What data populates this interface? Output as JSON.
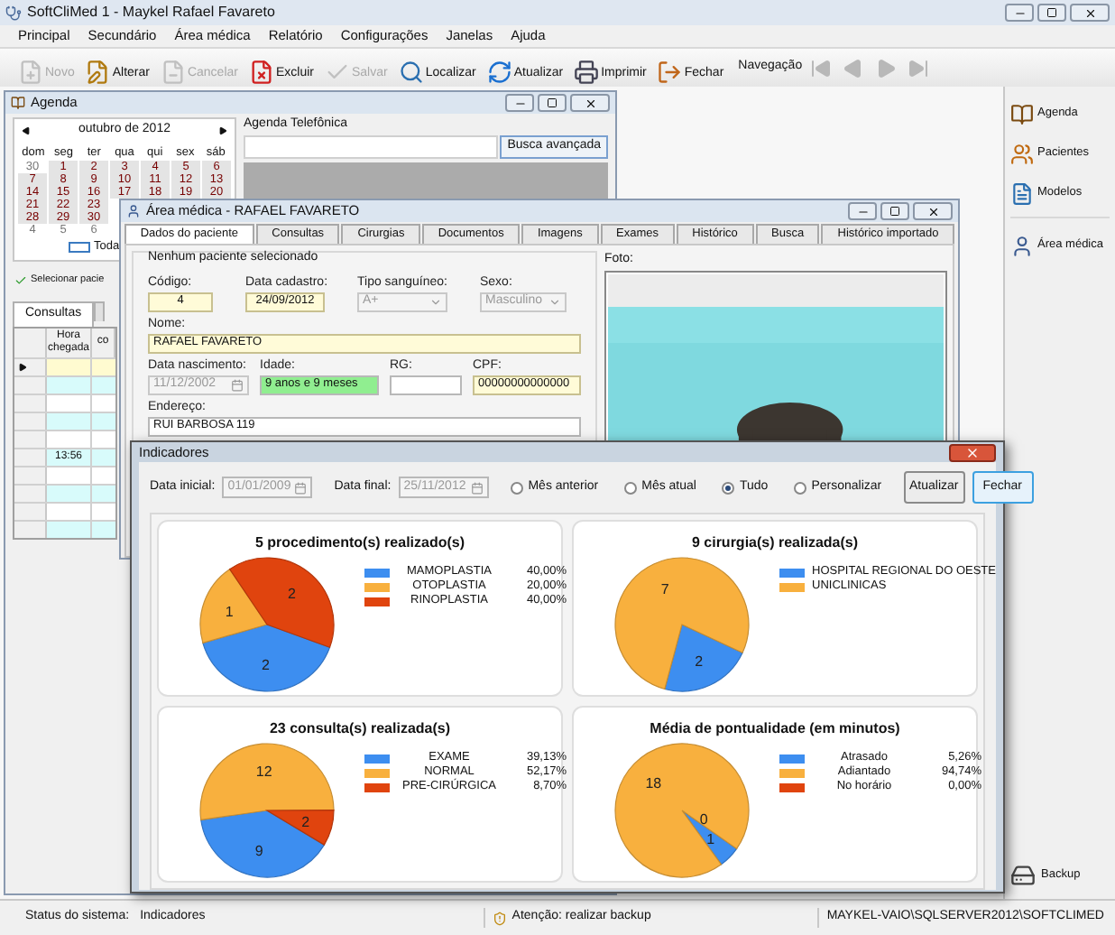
{
  "window": {
    "title": "SoftCliMed 1 - Maykel Rafael Favareto"
  },
  "menu": [
    "Principal",
    "Secundário",
    "Área médica",
    "Relatório",
    "Configurações",
    "Janelas",
    "Ajuda"
  ],
  "toolbar": [
    {
      "kind": "new",
      "label": "Novo",
      "disabled": true
    },
    {
      "kind": "edit",
      "label": "Alterar",
      "disabled": false
    },
    {
      "kind": "cancel",
      "label": "Cancelar",
      "disabled": true
    },
    {
      "kind": "delete",
      "label": "Excluir",
      "disabled": false
    },
    {
      "kind": "save",
      "label": "Salvar",
      "disabled": true
    },
    {
      "kind": "find",
      "label": "Localizar",
      "disabled": false
    },
    {
      "kind": "refresh",
      "label": "Atualizar",
      "disabled": false
    },
    {
      "kind": "print",
      "label": "Imprimir",
      "disabled": false
    },
    {
      "kind": "close",
      "label": "Fechar",
      "disabled": false
    }
  ],
  "navigation": {
    "label": "Navegação",
    "buttons": [
      {
        "kind": "first",
        "disabled": true
      },
      {
        "kind": "previous",
        "disabled": true
      },
      {
        "kind": "next",
        "disabled": true
      },
      {
        "kind": "last",
        "disabled": true
      }
    ]
  },
  "agenda_window": {
    "title": "Agenda",
    "calendar": {
      "month": "outubro de 2012",
      "weekdays": [
        "dom",
        "seg",
        "ter",
        "qua",
        "qui",
        "sex",
        "sáb"
      ],
      "weeks": [
        [
          {
            "day": "30",
            "other_month": true
          },
          {
            "day": "1",
            "other_month": false
          },
          {
            "day": "2",
            "other_month": false
          },
          {
            "day": "3",
            "other_month": false
          },
          {
            "day": "4",
            "other_month": false
          },
          {
            "day": "5",
            "other_month": false
          },
          {
            "day": "6",
            "other_month": false
          }
        ],
        [
          {
            "day": "7",
            "other_month": false
          },
          {
            "day": "8",
            "other_month": false
          },
          {
            "day": "9",
            "other_month": false
          },
          {
            "day": "10",
            "other_month": false
          },
          {
            "day": "11",
            "other_month": false
          },
          {
            "day": "12",
            "other_month": false
          },
          {
            "day": "13",
            "other_month": false
          }
        ],
        [
          {
            "day": "14",
            "other_month": false
          },
          {
            "day": "15",
            "other_month": false
          },
          {
            "day": "16",
            "other_month": false
          },
          {
            "day": "17",
            "other_month": false
          },
          {
            "day": "18",
            "other_month": false
          },
          {
            "day": "19",
            "other_month": false
          },
          {
            "day": "20",
            "other_month": false
          }
        ],
        [
          {
            "day": "21",
            "other_month": false
          },
          {
            "day": "22",
            "other_month": false
          },
          {
            "day": "23",
            "other_month": false
          }
        ],
        [
          {
            "day": "28",
            "other_month": false
          },
          {
            "day": "29",
            "other_month": false
          },
          {
            "day": "30",
            "other_month": false
          }
        ],
        [
          {
            "day": "4",
            "other_month": true
          },
          {
            "day": "5",
            "other_month": true
          },
          {
            "day": "6",
            "other_month": true
          }
        ]
      ],
      "today_label": "Toda"
    },
    "phone_book": {
      "title": "Agenda Telefônica",
      "button": "Busca avançada"
    },
    "select_patient": "Selecionar pacie",
    "tabs": [
      {
        "label": "Consultas",
        "selected": true
      }
    ],
    "grid": {
      "columns": [
        "Hora chegada",
        "co"
      ],
      "rows": [
        {
          "selected": true
        },
        {
          "selected": false
        },
        {
          "selected": false
        },
        {
          "selected": false
        },
        {
          "selected": false
        },
        {
          "selected": false,
          "arrival": "13:56"
        },
        {
          "selected": false
        },
        {
          "selected": false
        },
        {
          "selected": false
        },
        {
          "selected": false
        }
      ]
    }
  },
  "medical_window": {
    "title": "Área médica - RAFAEL FAVARETO",
    "tabs": [
      {
        "label": "Dados do paciente",
        "selected": true
      },
      {
        "label": "Consultas",
        "selected": false
      },
      {
        "label": "Cirurgias",
        "selected": false
      },
      {
        "label": "Documentos",
        "selected": false
      },
      {
        "label": "Imagens",
        "selected": false
      },
      {
        "label": "Exames",
        "selected": false
      },
      {
        "label": "Histórico",
        "selected": false
      },
      {
        "label": "Busca",
        "selected": false
      },
      {
        "label": "Histórico importado",
        "selected": false
      }
    ],
    "group_title": "Nenhum paciente selecionado",
    "field_rows": [
      [
        {
          "label": "Código:",
          "value": "4",
          "kind": "text",
          "required": true,
          "computed": false
        },
        {
          "label": "Data cadastro:",
          "value": "24/09/2012",
          "kind": "text",
          "required": true,
          "computed": false
        },
        {
          "label": "Tipo sanguíneo:",
          "value": "A+",
          "kind": "combo",
          "disabled": true
        },
        {
          "label": "Sexo:",
          "value": "Masculino",
          "kind": "combo",
          "disabled": true
        }
      ],
      [
        {
          "label": "Nome:",
          "value": "RAFAEL FAVARETO",
          "kind": "text",
          "required": true,
          "computed": false
        }
      ],
      [
        {
          "label": "Data nascimento:",
          "value": "11/12/2002",
          "kind": "date",
          "disabled": true
        },
        {
          "label": "Idade:",
          "value": "9 anos e 9 meses",
          "kind": "text",
          "required": false,
          "computed": true
        },
        {
          "label": "RG:",
          "kind": "text",
          "required": false,
          "computed": false
        },
        {
          "label": "CPF:",
          "value": "00000000000000",
          "kind": "text",
          "required": true,
          "computed": false
        }
      ],
      [
        {
          "label": "Endereço:",
          "value": "RUI BARBOSA 119",
          "kind": "text",
          "required": false,
          "computed": false
        }
      ]
    ],
    "photo_label": "Foto:"
  },
  "indicators": {
    "title": "Indicadores",
    "date_start": {
      "label": "Data inicial:",
      "value": "01/01/2009",
      "disabled": true
    },
    "date_end": {
      "label": "Data final:",
      "value": "25/11/2012",
      "disabled": true
    },
    "periods": [
      {
        "label": "Mês anterior",
        "selected": false
      },
      {
        "label": "Mês atual",
        "selected": false
      },
      {
        "label": "Tudo",
        "selected": true
      },
      {
        "label": "Personalizar",
        "selected": false
      }
    ],
    "buttons": [
      {
        "label": "Atualizar",
        "focused": false
      },
      {
        "label": "Fechar",
        "focused": true
      }
    ],
    "panels": [
      {
        "chart_data": {
          "type": "pie",
          "title": "5 procedimento(s) realizado(s)",
          "categories": [
            "MAMOPLASTIA",
            "OTOPLASTIA",
            "RINOPLASTIA"
          ],
          "values": [
            2,
            1,
            2
          ],
          "value_labels": [
            "2",
            "1",
            "2"
          ]
        },
        "legend": [
          {
            "color": "#3d8ef0",
            "percent": "40,00%"
          },
          {
            "color": "#f8b03e",
            "percent": "20,00%"
          },
          {
            "color": "#e0440e",
            "percent": "40,00%"
          }
        ]
      },
      {
        "chart_data": {
          "type": "pie",
          "title": "9 cirurgia(s) realizada(s)",
          "categories": [
            "HOSPITAL REGIONAL DO OESTE",
            "UNICLINICAS"
          ],
          "values": [
            2,
            7
          ],
          "value_labels": [
            "2",
            "7"
          ]
        },
        "legend": [
          {
            "color": "#3d8ef0"
          },
          {
            "color": "#f8b03e"
          }
        ]
      },
      {
        "chart_data": {
          "type": "pie",
          "title": "23 consulta(s) realizada(s)",
          "categories": [
            "EXAME",
            "NORMAL",
            "PRE-CIRÚRGICA"
          ],
          "values": [
            9,
            12,
            2
          ],
          "value_labels": [
            "9",
            "12",
            "2"
          ]
        },
        "legend": [
          {
            "color": "#3d8ef0",
            "percent": "39,13%"
          },
          {
            "color": "#f8b03e",
            "percent": "52,17%"
          },
          {
            "color": "#e0440e",
            "percent": "8,70%"
          }
        ]
      },
      {
        "chart_data": {
          "type": "pie",
          "title": "Média de pontualidade (em minutos)",
          "categories": [
            "Atrasado",
            "Adiantado",
            "No horário"
          ],
          "values": [
            1,
            18,
            0
          ],
          "value_labels": [
            "1",
            "18",
            "0"
          ]
        },
        "legend": [
          {
            "color": "#3d8ef0",
            "percent": "5,26%"
          },
          {
            "color": "#f8b03e",
            "percent": "94,74%"
          },
          {
            "color": "#e0440e",
            "percent": "0,00%"
          }
        ]
      }
    ]
  },
  "sidebar": {
    "items": [
      {
        "kind": "agenda",
        "label": "Agenda"
      },
      {
        "kind": "patients",
        "label": "Pacientes"
      },
      {
        "kind": "templates",
        "label": "Modelos"
      },
      {
        "kind": "medical",
        "label": "Área médica"
      }
    ],
    "backup": {
      "label": "Backup"
    }
  },
  "status_bar": {
    "label": "Status do sistema:",
    "value": "Indicadores",
    "warning": "Atenção: realizar backup",
    "connection": "MAYKEL-VAIO\\SQLSERVER2012\\SOFTCLIMED"
  }
}
